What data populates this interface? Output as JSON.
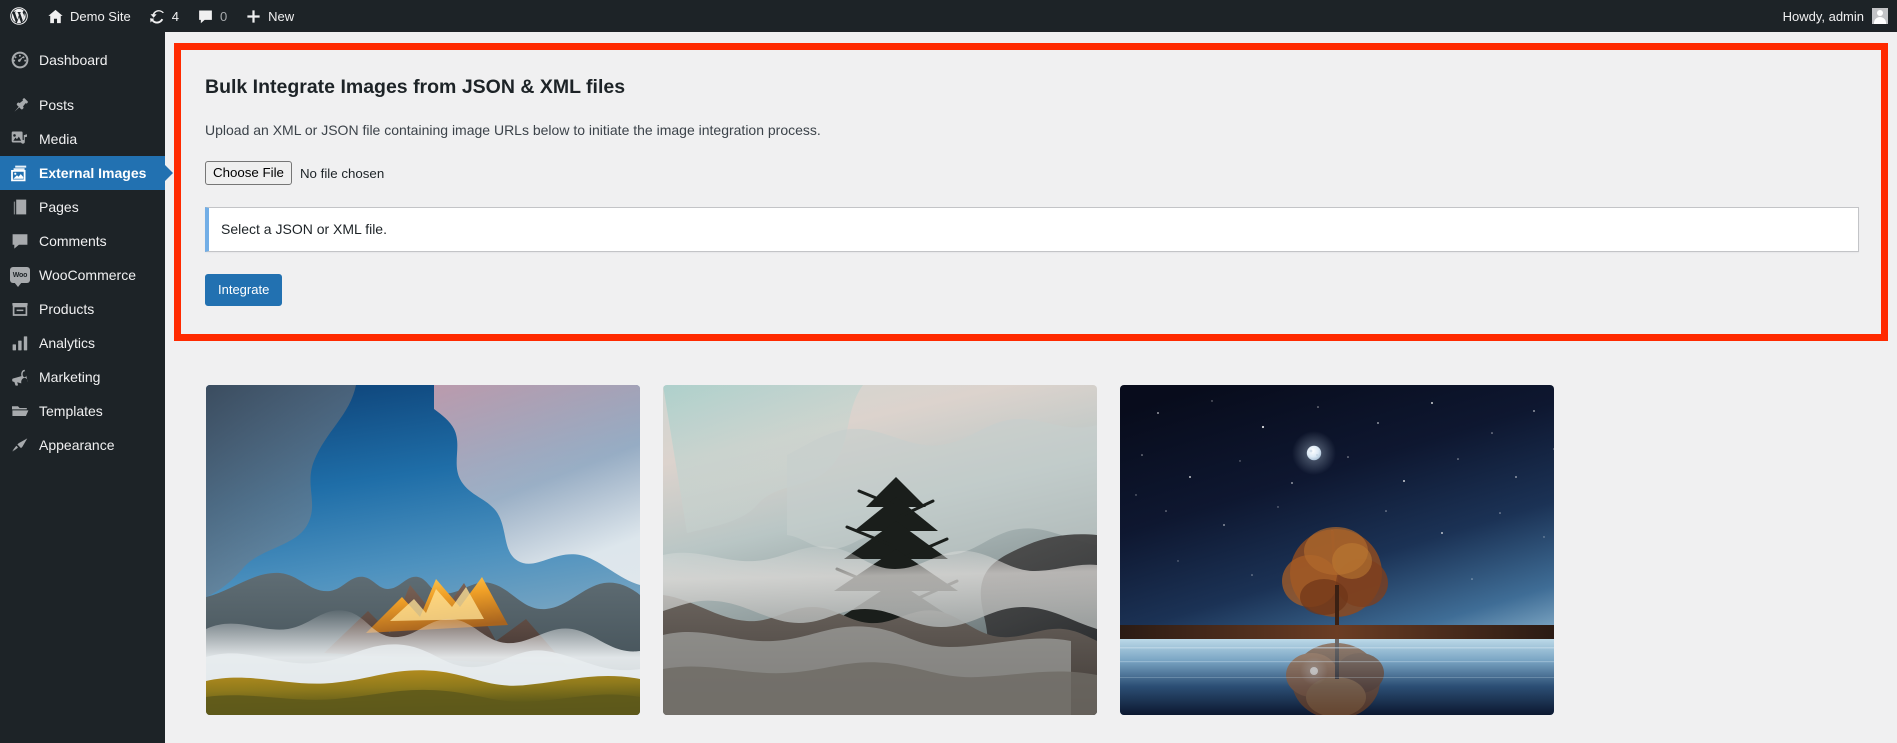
{
  "adminbar": {
    "wp_logo_icon": "wordpress-logo-icon",
    "site_icon": "home-icon",
    "site_name": "Demo Site",
    "updates_icon": "updates-icon",
    "updates_count": "4",
    "comments_icon": "comment-bubble-icon",
    "comments_count": "0",
    "new_icon": "plus-icon",
    "new_label": "New",
    "howdy": "Howdy, admin",
    "avatar_icon": "user-avatar-icon"
  },
  "sidebar": {
    "items": [
      {
        "label": "Dashboard",
        "icon": "dashboard-gauge-icon",
        "current": false
      },
      {
        "label": "Posts",
        "icon": "pushpin-icon",
        "current": false
      },
      {
        "label": "Media",
        "icon": "media-photo-note-icon",
        "current": false
      },
      {
        "label": "External Images",
        "icon": "images-stack-icon",
        "current": true
      },
      {
        "label": "Pages",
        "icon": "pages-icon",
        "current": false
      },
      {
        "label": "Comments",
        "icon": "comment-bubble-icon",
        "current": false
      },
      {
        "label": "WooCommerce",
        "icon": "woocommerce-icon",
        "current": false
      },
      {
        "label": "Products",
        "icon": "products-box-icon",
        "current": false
      },
      {
        "label": "Analytics",
        "icon": "bar-chart-icon",
        "current": false
      },
      {
        "label": "Marketing",
        "icon": "megaphone-icon",
        "current": false
      },
      {
        "label": "Templates",
        "icon": "folder-open-icon",
        "current": false
      },
      {
        "label": "Appearance",
        "icon": "paintbrush-icon",
        "current": false
      }
    ]
  },
  "panel": {
    "title": "Bulk Integrate Images from JSON & XML files",
    "description": "Upload an XML or JSON file containing image URLs below to initiate the image integration process.",
    "choose_file_label": "Choose File",
    "file_status": "No file chosen",
    "notice_text": "Select a JSON or XML file.",
    "submit_label": "Integrate",
    "highlight_color": "#ff2a00",
    "accent_color": "#2271b1",
    "notice_border_color": "#72aee6"
  },
  "gallery": {
    "items": [
      {
        "name": "mountain-sunrise-thumbnail"
      },
      {
        "name": "foggy-pine-mountain-thumbnail"
      },
      {
        "name": "starry-night-tree-reflection-thumbnail"
      }
    ]
  }
}
